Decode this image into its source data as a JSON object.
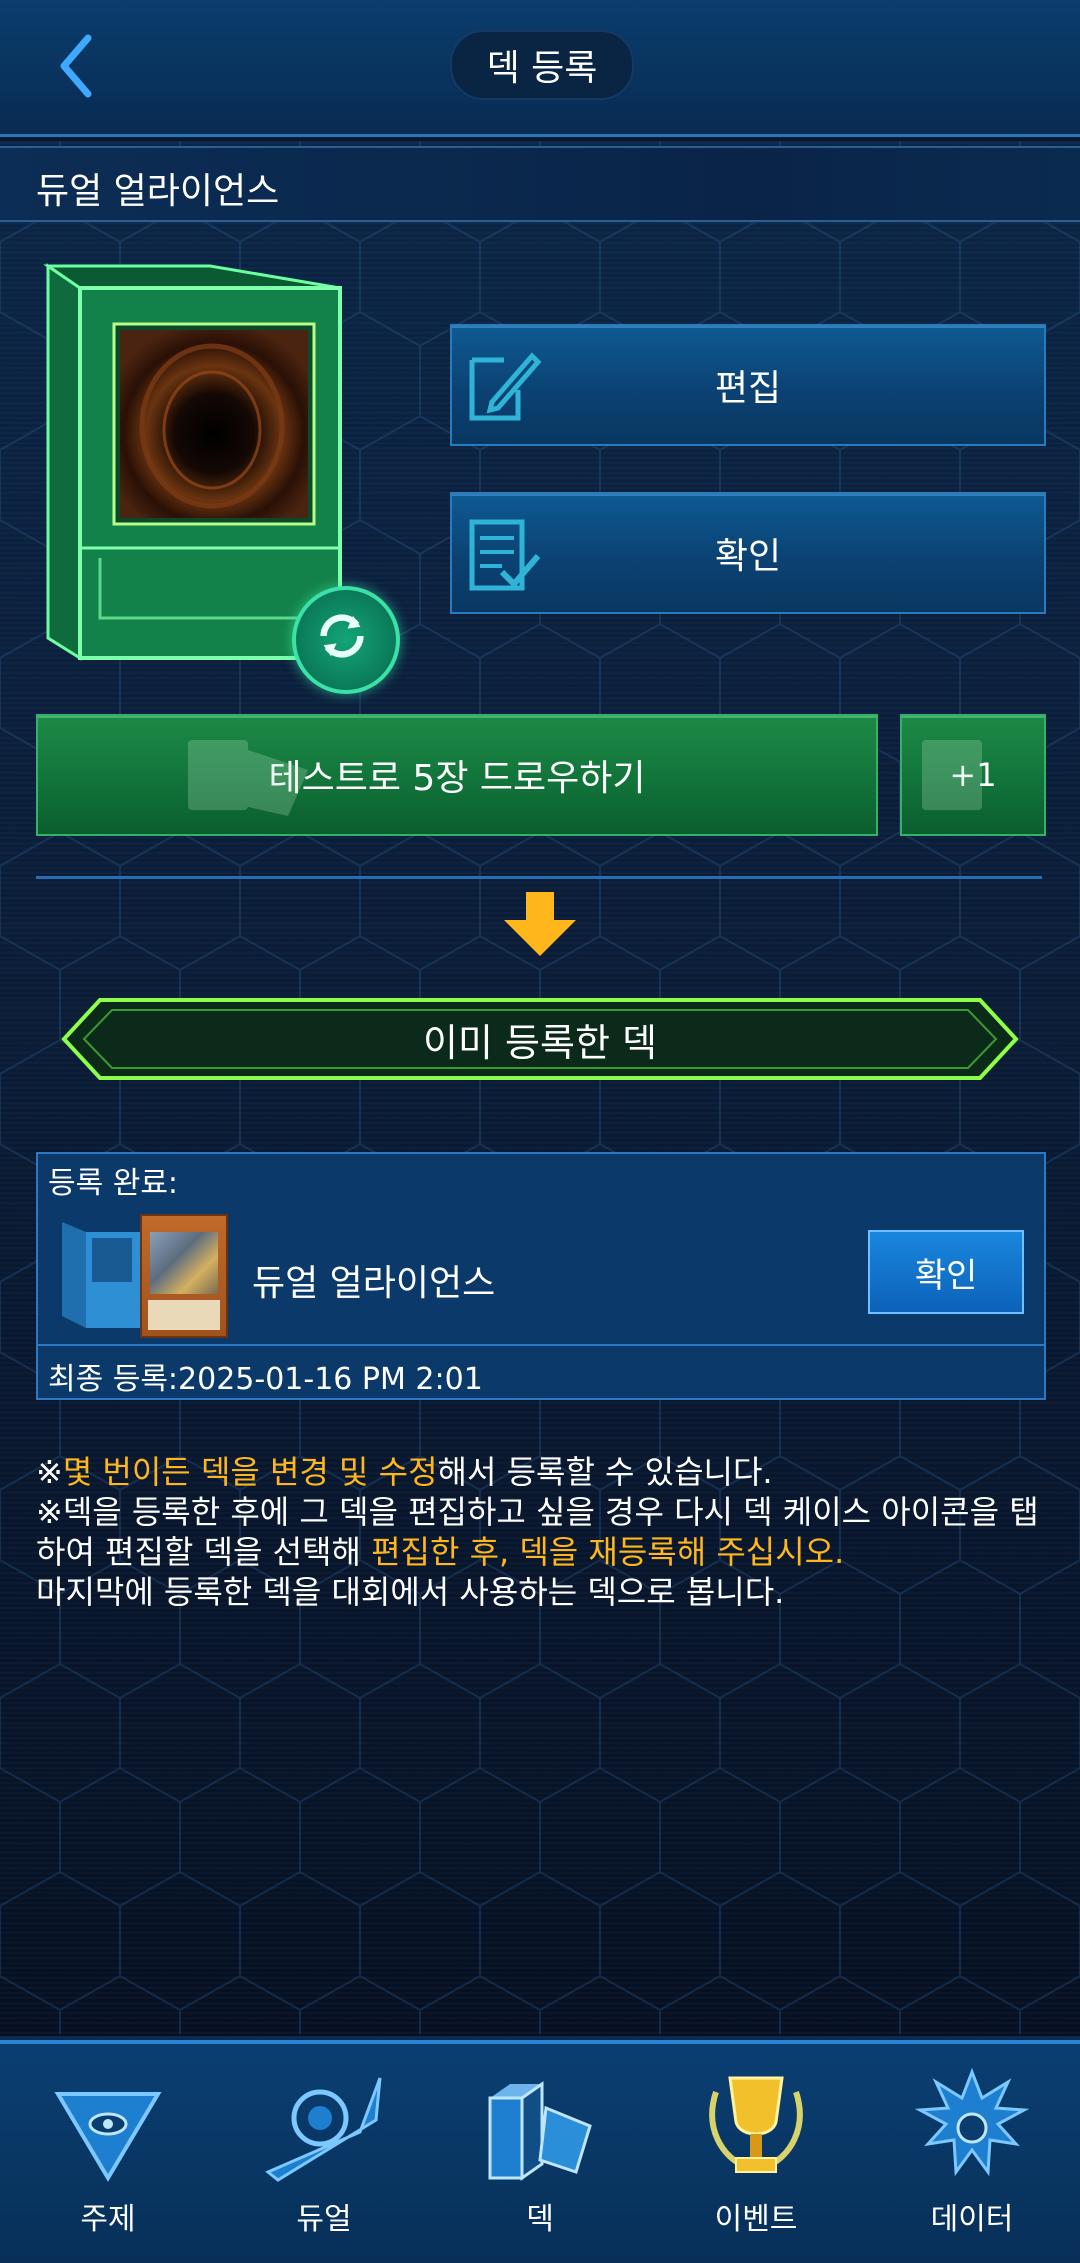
{
  "header": {
    "title": "덱 등록"
  },
  "deck": {
    "name": "듀얼 얼라이언스"
  },
  "actions": {
    "edit_label": "편집",
    "confirm_label": "확인"
  },
  "draw": {
    "test_label": "테스트로 5장 드로우하기",
    "plus_label": "+1"
  },
  "registered": {
    "banner": "이미 등록한 덱",
    "done_label": "등록 완료:",
    "deck_name": "듀얼 얼라이언스",
    "confirm_label": "확인",
    "last_registered": "최종 등록:2025-01-16 PM 2:01"
  },
  "notes": {
    "line1_prefix": "※",
    "line1_highlight": "몇 번이든 덱을 변경 및 수정",
    "line1_suffix": "해서 등록할 수 있습니다.",
    "line2_text": "※덱을 등록한 후에 그 덱을 편집하고 싶을 경우 다시 덱 케이스 아이콘을 탭하여 편집할 덱을 선택해 ",
    "line2_highlight": "편집한 후, 덱을 재등록해 주십시오.",
    "line3": "마지막에 등록한 덱을 대회에서 사용하는 덱으로 봅니다."
  },
  "nav": [
    {
      "label": "주제",
      "icon": "millennium-pyramid-icon"
    },
    {
      "label": "듀얼",
      "icon": "duel-disk-icon"
    },
    {
      "label": "덱",
      "icon": "deck-icon"
    },
    {
      "label": "이벤트",
      "icon": "trophy-icon"
    },
    {
      "label": "데이터",
      "icon": "character-data-icon"
    }
  ],
  "colors": {
    "highlight": "#ffb71c",
    "green_button": "#11743a",
    "blue_button": "#0b4273"
  }
}
